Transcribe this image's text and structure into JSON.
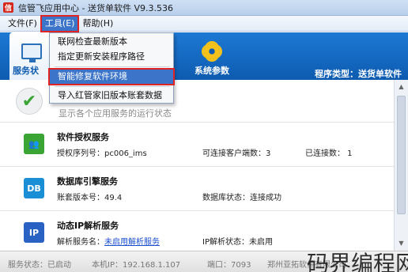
{
  "window": {
    "title": "信管飞应用中心 - 送货单软件 V9.3.536",
    "logo": "信"
  },
  "menubar": {
    "items": [
      "文件(F)",
      "工具(E)",
      "帮助(H)"
    ]
  },
  "dropdown": {
    "items": [
      "联网检查最新版本",
      "指定更新安装程序路径",
      "智能修复软件环境",
      "导入红管家旧版本账套数据"
    ]
  },
  "toolbar": {
    "status_label": "服务状",
    "system_label": "系统参数",
    "program_type": "程序类型：送货单软件"
  },
  "status": {
    "description": "显示各个应用服务的运行状态"
  },
  "services": [
    {
      "title": "软件授权服务",
      "line1": "授权序列号：pc006_ims",
      "line2": "可连接客户端数：3",
      "line3": "已连接数：  1",
      "icon_text": "👥"
    },
    {
      "title": "数据库引擎服务",
      "line1": "账套版本号：49.4",
      "line2": "数据库状态：连接成功",
      "icon_text": "DB"
    },
    {
      "title": "动态IP解析服务",
      "line1_prefix": "解析服务名：",
      "line1_link": "未启用解析服务",
      "line2": "IP解析状态：未启用",
      "icon_text": "IP"
    }
  ],
  "bottombar": {
    "service_status": "服务状态：已启动",
    "local_ip": "本机IP：192.168.1.107",
    "port": "端口：7093",
    "company": "郑州亚拓软件有限公司"
  },
  "watermark": "码界编程网",
  "colors": {
    "accent": "#0d5bb0",
    "highlight": "#3b74c9",
    "annotation": "#e02424"
  }
}
